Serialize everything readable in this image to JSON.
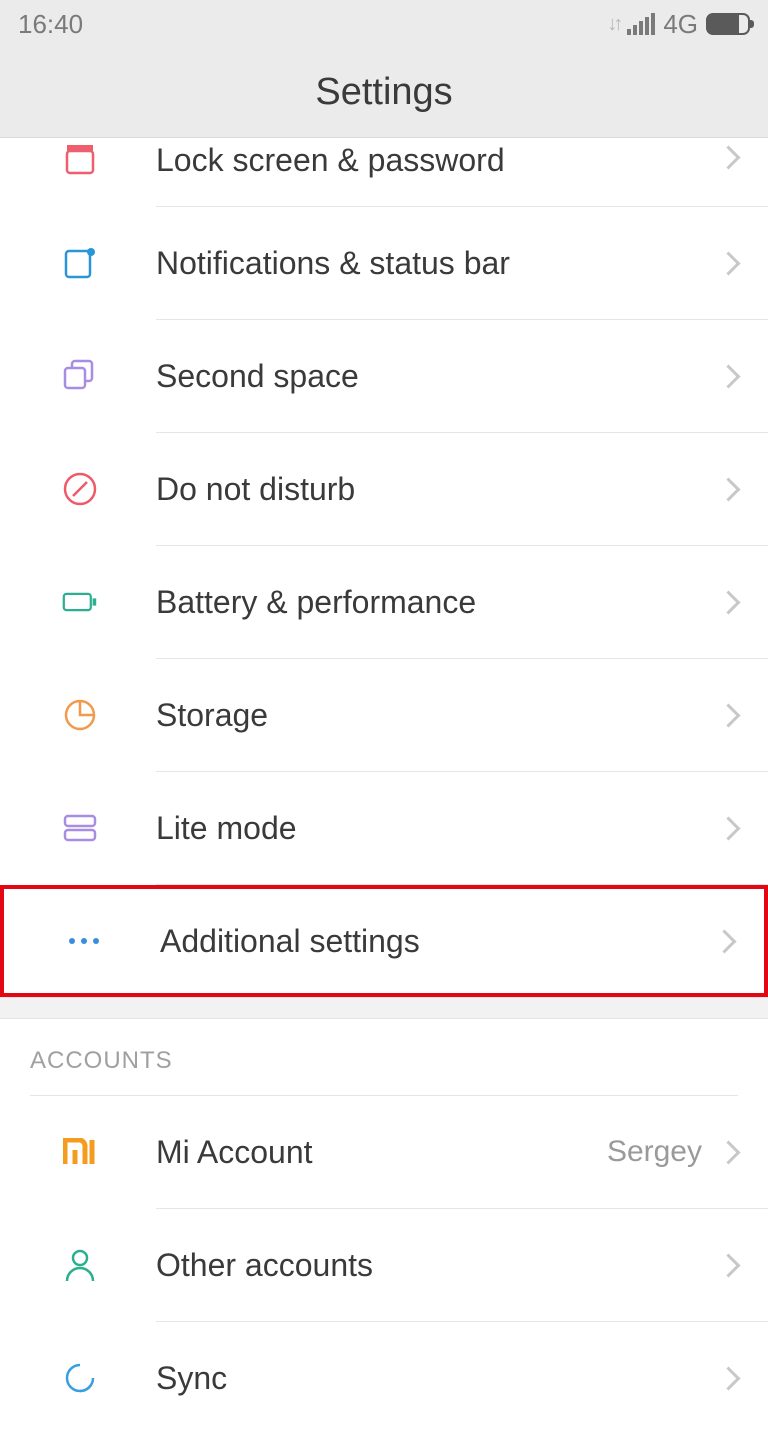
{
  "status": {
    "time": "16:40",
    "network": "4G"
  },
  "header": {
    "title": "Settings"
  },
  "items": [
    {
      "label": "Lock screen & password",
      "icon": "lock-icon",
      "color": "#ed5e6f"
    },
    {
      "label": "Notifications & status bar",
      "icon": "notification-icon",
      "color": "#2a96d8"
    },
    {
      "label": "Second space",
      "icon": "second-space-icon",
      "color": "#a88de4"
    },
    {
      "label": "Do not disturb",
      "icon": "dnd-icon",
      "color": "#ee5a6a"
    },
    {
      "label": "Battery & performance",
      "icon": "battery-icon",
      "color": "#2ab090"
    },
    {
      "label": "Storage",
      "icon": "storage-icon",
      "color": "#f2994a"
    },
    {
      "label": "Lite mode",
      "icon": "lite-mode-icon",
      "color": "#a88de4"
    },
    {
      "label": "Additional settings",
      "icon": "more-icon",
      "color": "#3a8dde"
    }
  ],
  "accounts_section": {
    "title": "ACCOUNTS",
    "items": [
      {
        "label": "Mi Account",
        "icon": "mi-icon",
        "color": "#f39c1f",
        "value": "Sergey"
      },
      {
        "label": "Other accounts",
        "icon": "person-icon",
        "color": "#2ab090",
        "value": ""
      },
      {
        "label": "Sync",
        "icon": "sync-icon",
        "color": "#3a9fe0",
        "value": ""
      }
    ]
  }
}
